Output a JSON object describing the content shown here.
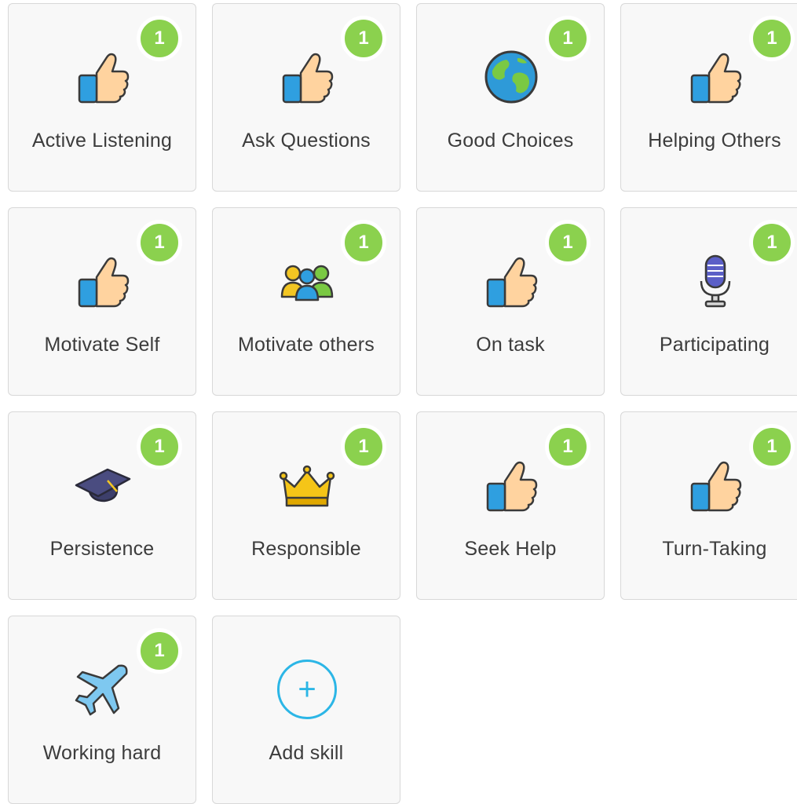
{
  "skills": [
    {
      "label": "Active Listening",
      "count": "1",
      "icon": "thumbs-up-icon"
    },
    {
      "label": "Ask Questions",
      "count": "1",
      "icon": "thumbs-up-icon"
    },
    {
      "label": "Good Choices",
      "count": "1",
      "icon": "globe-icon"
    },
    {
      "label": "Helping Others",
      "count": "1",
      "icon": "thumbs-up-icon"
    },
    {
      "label": "Motivate Self",
      "count": "1",
      "icon": "thumbs-up-icon"
    },
    {
      "label": "Motivate others",
      "count": "1",
      "icon": "people-group-icon"
    },
    {
      "label": "On task",
      "count": "1",
      "icon": "thumbs-up-icon"
    },
    {
      "label": "Participating",
      "count": "1",
      "icon": "microphone-icon"
    },
    {
      "label": "Persistence",
      "count": "1",
      "icon": "graduation-cap-icon"
    },
    {
      "label": "Responsible",
      "count": "1",
      "icon": "crown-icon"
    },
    {
      "label": "Seek Help",
      "count": "1",
      "icon": "thumbs-up-icon"
    },
    {
      "label": "Turn-Taking",
      "count": "1",
      "icon": "thumbs-up-icon"
    },
    {
      "label": "Working hard",
      "count": "1",
      "icon": "airplane-icon"
    }
  ],
  "add_skill": {
    "label": "Add skill",
    "symbol": "+",
    "icon": "plus-circle-icon"
  },
  "colors": {
    "badge": "#8bd14e",
    "accent": "#2cb6e6",
    "tile_bg": "#f8f8f8",
    "tile_border": "#d8d8d8",
    "label_text": "#3c3c3c"
  }
}
